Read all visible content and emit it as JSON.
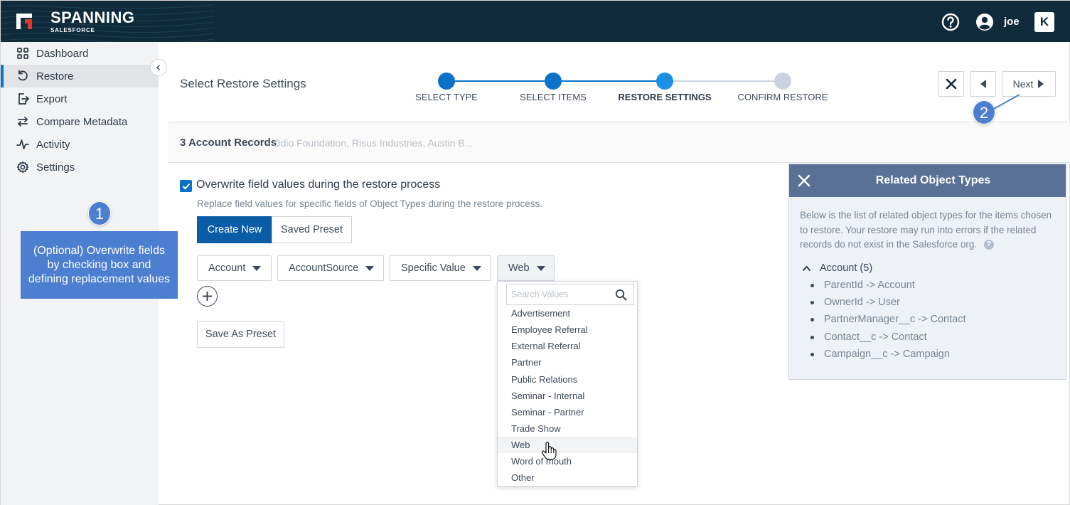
{
  "header": {
    "logo_text": "SPANNING",
    "logo_sub": "SALESFORCE",
    "user_name": "joe",
    "brand_badge": "K"
  },
  "sidebar": {
    "items": [
      {
        "label": "Dashboard",
        "icon": "dashboard-grid-icon"
      },
      {
        "label": "Restore",
        "icon": "restore-undo-icon",
        "active": true
      },
      {
        "label": "Export",
        "icon": "export-icon"
      },
      {
        "label": "Compare Metadata",
        "icon": "compare-arrows-icon"
      },
      {
        "label": "Activity",
        "icon": "activity-pulse-icon"
      },
      {
        "label": "Settings",
        "icon": "gear-icon"
      }
    ]
  },
  "annotations": {
    "badge_1": "1",
    "badge_2": "2",
    "callout_1": "(Optional) Overwrite fields\nby checking box and\ndefining replacement values"
  },
  "main": {
    "page_title": "Select Restore Settings",
    "steps": [
      {
        "label": "SELECT TYPE",
        "state": "done"
      },
      {
        "label": "SELECT ITEMS",
        "state": "done"
      },
      {
        "label": "RESTORE SETTINGS",
        "state": "current"
      },
      {
        "label": "CONFIRM RESTORE",
        "state": "pending"
      }
    ],
    "next_label": "Next",
    "records_title": "3 Account Records",
    "records_names": "- Odio Foundation, Risus Industries, Austin B...",
    "overwrite_label": "Overwrite field values during the restore process",
    "overwrite_checked": true,
    "overwrite_hint": "Replace field values for specific fields of Object Types during the restore process.",
    "create_new_label": "Create New",
    "saved_preset_label": "Saved Preset",
    "dropdowns": [
      "Account",
      "AccountSource",
      "Specific Value",
      "Web"
    ],
    "save_preset_label": "Save As Preset",
    "value_menu": {
      "search_placeholder": "Search Values",
      "options": [
        "Advertisement",
        "Employee Referral",
        "External Referral",
        "Partner",
        "Public Relations",
        "Seminar - Internal",
        "Seminar - Partner",
        "Trade Show",
        "Web",
        "Word of mouth",
        "Other"
      ],
      "hovered": "Web"
    }
  },
  "related_panel": {
    "title": "Related Object Types",
    "description": "Below is the list of related object types for the items chosen to restore. Your restore may run into errors if the related records do not exist in the Salesforce org.",
    "help_glyph": "?",
    "group_label": "Account (5)",
    "items": [
      "ParentId -> Account",
      "OwnerId -> User",
      "PartnerManager__c -> Contact",
      "Contact__c -> Contact",
      "Campaign__c -> Campaign"
    ]
  },
  "colors": {
    "header_bg": "#0f2a3b",
    "primary": "#0a5ca6",
    "step_done": "#0a72c8",
    "step_current": "#1c8fe6",
    "step_pending": "#cdd3de",
    "annotation": "#4d7fd0",
    "panel_head": "#5a7196"
  }
}
